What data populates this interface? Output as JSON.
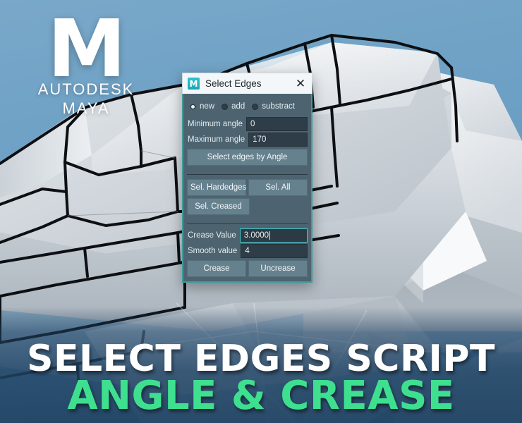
{
  "app": {
    "logo_letter": "M",
    "logo_brand": "AUTODESK",
    "logo_product": "MAYA"
  },
  "banner": {
    "line1": "SELECT EDGES SCRIPT",
    "line2": "ANGLE & CREASE",
    "line1_color": "#ffffff",
    "line2_color": "#3ee08f"
  },
  "dialog": {
    "icon_name": "maya-app-icon",
    "icon_letter": "M",
    "title": "Select Edges",
    "close_label": "✕",
    "mode_options": [
      {
        "label": "new",
        "selected": true
      },
      {
        "label": "add",
        "selected": false
      },
      {
        "label": "substract",
        "selected": false
      }
    ],
    "fields": {
      "minimum_angle_label": "Minimum angle",
      "minimum_angle_value": "0",
      "maximum_angle_label": "Maximum angle",
      "maximum_angle_value": "170",
      "crease_value_label": "Crease Value",
      "crease_value_value": "3.0000",
      "smooth_value_label": "Smooth value",
      "smooth_value_value": "4"
    },
    "buttons": {
      "select_by_angle": "Select edges by Angle",
      "sel_hardedges": "Sel. Hardedges",
      "sel_all": "Sel. All",
      "sel_creased": "Sel. Creased",
      "crease": "Crease",
      "uncrease": "Uncrease"
    },
    "colors": {
      "body_bg": "#4d6470",
      "border": "#3d9c9c",
      "titlebar_bg": "#f4f7f9",
      "field_bg": "#2e3d47",
      "field_focus_border": "#3ec8cd",
      "button_bg": "#66818e"
    }
  },
  "viewport": {
    "background_color": "#6b9fc4",
    "banner_overlay_color": "#264463",
    "mesh_fill": "#d4d9dd",
    "wireframe_color": "#0d0f12"
  }
}
